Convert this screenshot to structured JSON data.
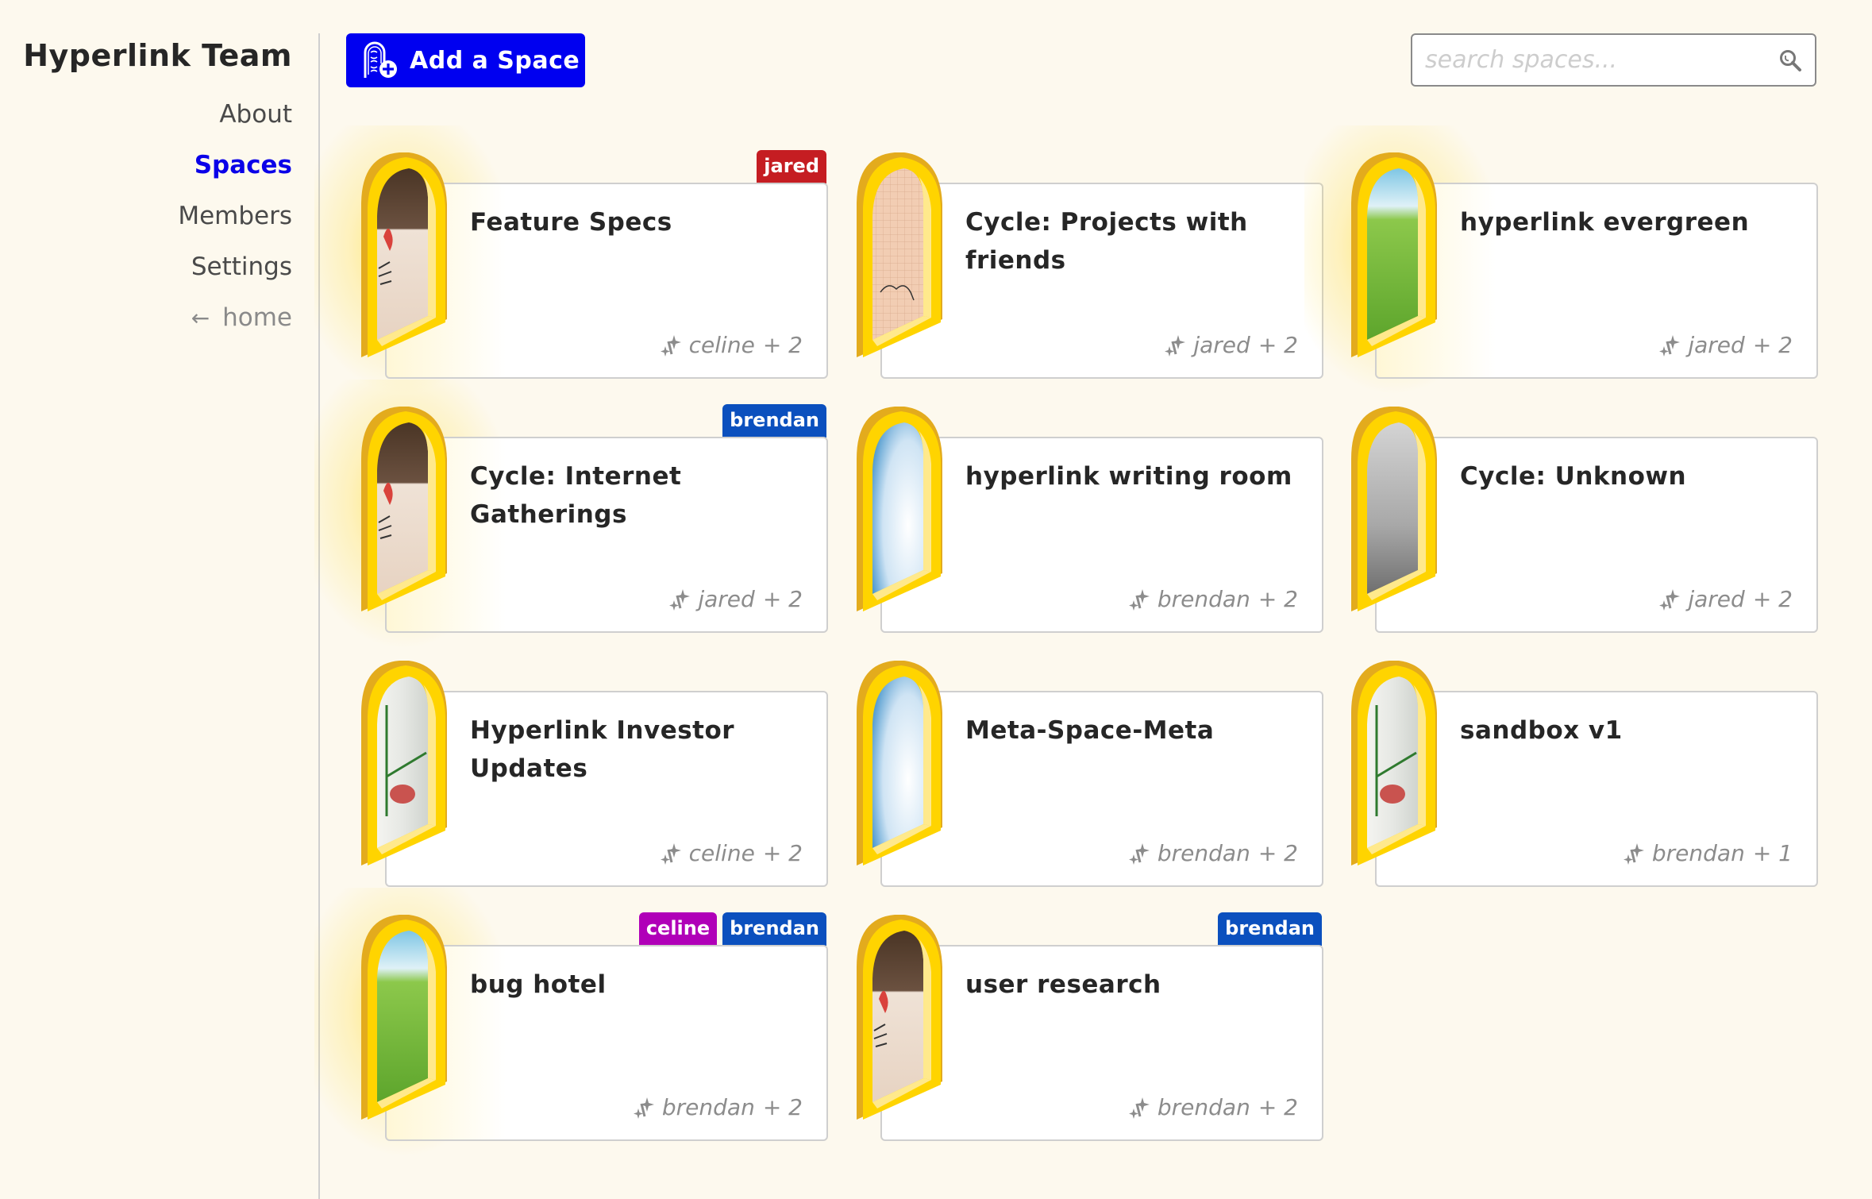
{
  "sidebar": {
    "team_title": "Hyperlink Team",
    "nav": [
      {
        "label": "About",
        "active": false
      },
      {
        "label": "Spaces",
        "active": true
      },
      {
        "label": "Members",
        "active": false
      },
      {
        "label": "Settings",
        "active": false
      }
    ],
    "back": {
      "icon": "arrow-left-icon",
      "label": "home"
    }
  },
  "toolbar": {
    "add_label": "Add a Space",
    "add_icon": "door-plus-icon",
    "search_placeholder": "search spaces...",
    "search_value": "",
    "search_icon": "magnifier-icon"
  },
  "colors": {
    "accent": "#0000f0",
    "background": "#fdf9ee",
    "door_frame": "#ffd400",
    "members": {
      "jared": "#c51d22",
      "brendan": "#0b50be",
      "celine": "#b000b8"
    }
  },
  "spaces": [
    {
      "title": "Feature Specs",
      "owner": "celine",
      "extra": "+ 2",
      "badges": [
        "jared"
      ],
      "lit": true,
      "scene": "hen"
    },
    {
      "title": "Cycle: Projects with friends",
      "owner": "jared",
      "extra": "+ 2",
      "badges": [],
      "lit": false,
      "scene": "grid-paper"
    },
    {
      "title": "hyperlink evergreen",
      "owner": "jared",
      "extra": "+ 2",
      "badges": [],
      "lit": true,
      "scene": "meadow"
    },
    {
      "title": "Cycle: Internet Gatherings",
      "owner": "jared",
      "extra": "+ 2",
      "badges": [
        "brendan"
      ],
      "lit": true,
      "scene": "hen"
    },
    {
      "title": "hyperlink writing room",
      "owner": "brendan",
      "extra": "+ 2",
      "badges": [],
      "lit": false,
      "scene": "clouds"
    },
    {
      "title": "Cycle: Unknown",
      "owner": "jared",
      "extra": "+ 2",
      "badges": [],
      "lit": false,
      "scene": "static"
    },
    {
      "title": "Hyperlink Investor Updates",
      "owner": "celine",
      "extra": "+ 2",
      "badges": [],
      "lit": false,
      "scene": "room"
    },
    {
      "title": "Meta-Space-Meta",
      "owner": "brendan",
      "extra": "+ 2",
      "badges": [],
      "lit": false,
      "scene": "clouds"
    },
    {
      "title": "sandbox v1",
      "owner": "brendan",
      "extra": "+ 1",
      "badges": [],
      "lit": false,
      "scene": "room"
    },
    {
      "title": "bug hotel",
      "owner": "brendan",
      "extra": "+ 2",
      "badges": [
        "celine",
        "brendan"
      ],
      "lit": true,
      "scene": "meadow"
    },
    {
      "title": "user research",
      "owner": "brendan",
      "extra": "+ 2",
      "badges": [
        "brendan"
      ],
      "lit": false,
      "scene": "hen"
    }
  ]
}
